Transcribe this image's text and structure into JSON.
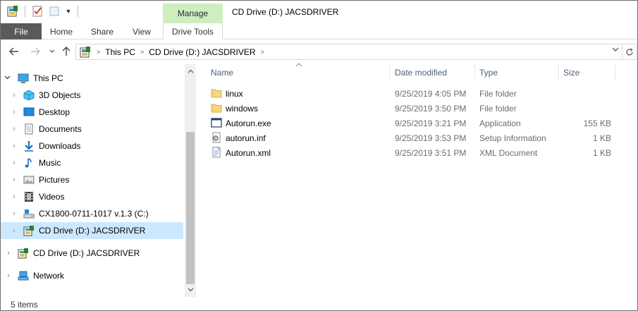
{
  "window": {
    "title": "CD Drive (D:) JACSDRIVER",
    "context_tab": "Manage"
  },
  "ribbon": {
    "tabs": [
      {
        "label": "File"
      },
      {
        "label": "Home"
      },
      {
        "label": "Share"
      },
      {
        "label": "View"
      },
      {
        "label": "Drive Tools"
      }
    ]
  },
  "address": {
    "breadcrumbs": [
      "This PC",
      "CD Drive (D:) JACSDRIVER"
    ]
  },
  "nav": {
    "items": [
      {
        "label": "This PC",
        "icon": "computer-icon"
      },
      {
        "label": "3D Objects",
        "icon": "3d-objects-icon"
      },
      {
        "label": "Desktop",
        "icon": "desktop-icon"
      },
      {
        "label": "Documents",
        "icon": "documents-icon"
      },
      {
        "label": "Downloads",
        "icon": "downloads-icon"
      },
      {
        "label": "Music",
        "icon": "music-icon"
      },
      {
        "label": "Pictures",
        "icon": "pictures-icon"
      },
      {
        "label": "Videos",
        "icon": "videos-icon"
      },
      {
        "label": "CX1800-0711-1017 v.1.3 (C:)",
        "icon": "hard-drive-icon"
      },
      {
        "label": "CD Drive (D:) JACSDRIVER",
        "icon": "cd-drive-icon",
        "selected": true
      },
      {
        "label": "CD Drive (D:) JACSDRIVER",
        "icon": "cd-drive-icon"
      },
      {
        "label": "Network",
        "icon": "network-icon"
      }
    ]
  },
  "columns": {
    "name": "Name",
    "date_modified": "Date modified",
    "type": "Type",
    "size": "Size"
  },
  "files": [
    {
      "name": "linux",
      "date": "9/25/2019 4:05 PM",
      "type": "File folder",
      "size": "",
      "icon": "folder-icon"
    },
    {
      "name": "windows",
      "date": "9/25/2019 3:50 PM",
      "type": "File folder",
      "size": "",
      "icon": "folder-icon"
    },
    {
      "name": "Autorun.exe",
      "date": "9/25/2019 3:21 PM",
      "type": "Application",
      "size": "155 KB",
      "icon": "application-icon"
    },
    {
      "name": "autorun.inf",
      "date": "9/25/2019 3:53 PM",
      "type": "Setup Information",
      "size": "1 KB",
      "icon": "setup-info-icon"
    },
    {
      "name": "Autorun.xml",
      "date": "9/25/2019 3:51 PM",
      "type": "XML Document",
      "size": "1 KB",
      "icon": "xml-document-icon"
    }
  ],
  "status": {
    "item_count": "5 items"
  },
  "colors": {
    "selection": "#cce8ff",
    "manage_tab": "#cdeebf",
    "file_tab": "#5a5a5a",
    "header_text": "#4c607a",
    "folder": "#f5d77a"
  }
}
